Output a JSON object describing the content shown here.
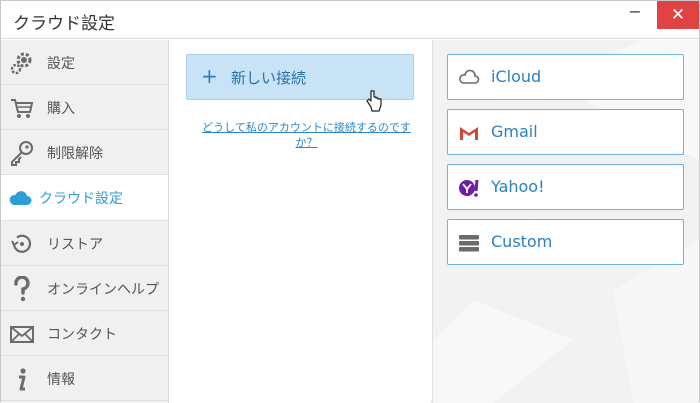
{
  "window": {
    "title": "クラウド設定",
    "minimize": "−",
    "close": "✕"
  },
  "sidebar": {
    "items": [
      {
        "label": "設定",
        "icon": "gear-icon"
      },
      {
        "label": "購入",
        "icon": "cart-icon"
      },
      {
        "label": "制限解除",
        "icon": "key-icon"
      },
      {
        "label": "クラウド設定",
        "icon": "cloud-icon",
        "active": true
      },
      {
        "label": "リストア",
        "icon": "restore-icon"
      },
      {
        "label": "オンラインヘルプ",
        "icon": "question-icon"
      },
      {
        "label": "コンタクト",
        "icon": "envelope-icon"
      },
      {
        "label": "情報",
        "icon": "info-icon"
      }
    ]
  },
  "middle": {
    "new_connection_plus": "+",
    "new_connection_label": "新しい接続",
    "help_link": "どうして私のアカウントに接続するのですか？"
  },
  "services": [
    {
      "label": "iCloud",
      "icon": "icloud-icon"
    },
    {
      "label": "Gmail",
      "icon": "gmail-icon"
    },
    {
      "label": "Yahoo!",
      "icon": "yahoo-icon"
    },
    {
      "label": "Custom",
      "icon": "server-icon"
    }
  ],
  "colors": {
    "accent": "#2d9ed8",
    "button_bg": "#c7e3f5",
    "close_bg": "#e04343"
  }
}
